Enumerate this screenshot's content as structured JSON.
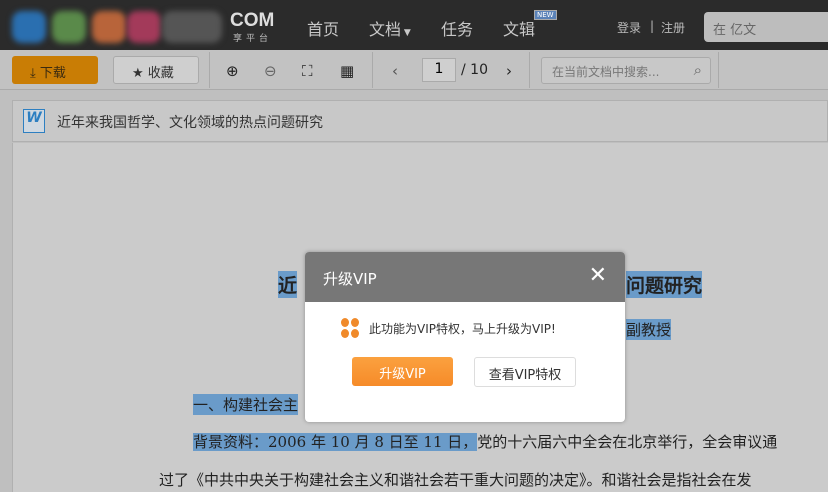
{
  "nav": {
    "logo_com": "COM",
    "logo_sub": "享平台",
    "items": [
      "首页",
      "文档",
      "任务",
      "文辑"
    ],
    "new_badge": "NEW",
    "login": "登录",
    "sep": "|",
    "register": "注册",
    "search_placeholder": "在        亿文"
  },
  "toolbar": {
    "download": "下载",
    "favorite": "收藏",
    "page_current": "1",
    "page_total": "/ 10",
    "search_placeholder": "在当前文档中搜索..."
  },
  "document": {
    "title": "近年来我国哲学、文化领域的热点问题研究",
    "heading_left": "近",
    "heading_right": "问题研究",
    "author_right": "副教授",
    "section_left": "一、构建社会主",
    "para1_hl": "背景资料：2006 年 10 月 8 日至 11 日，",
    "para1_rest": "党的十六届六中全会在北京举行，全会审议通",
    "para2": "过了《中共中央关于构建社会主义和谐社会若干重大问题的决定》。和谐社会是指社会在发"
  },
  "modal": {
    "title": "升级VIP",
    "message": "此功能为VIP特权，马上升级为VIP!",
    "upgrade": "升级VIP",
    "view": "查看VIP特权"
  },
  "colors": {
    "download": "#c97d05",
    "upgrade": "#f68b29",
    "highlight": "#6a9bc9"
  }
}
